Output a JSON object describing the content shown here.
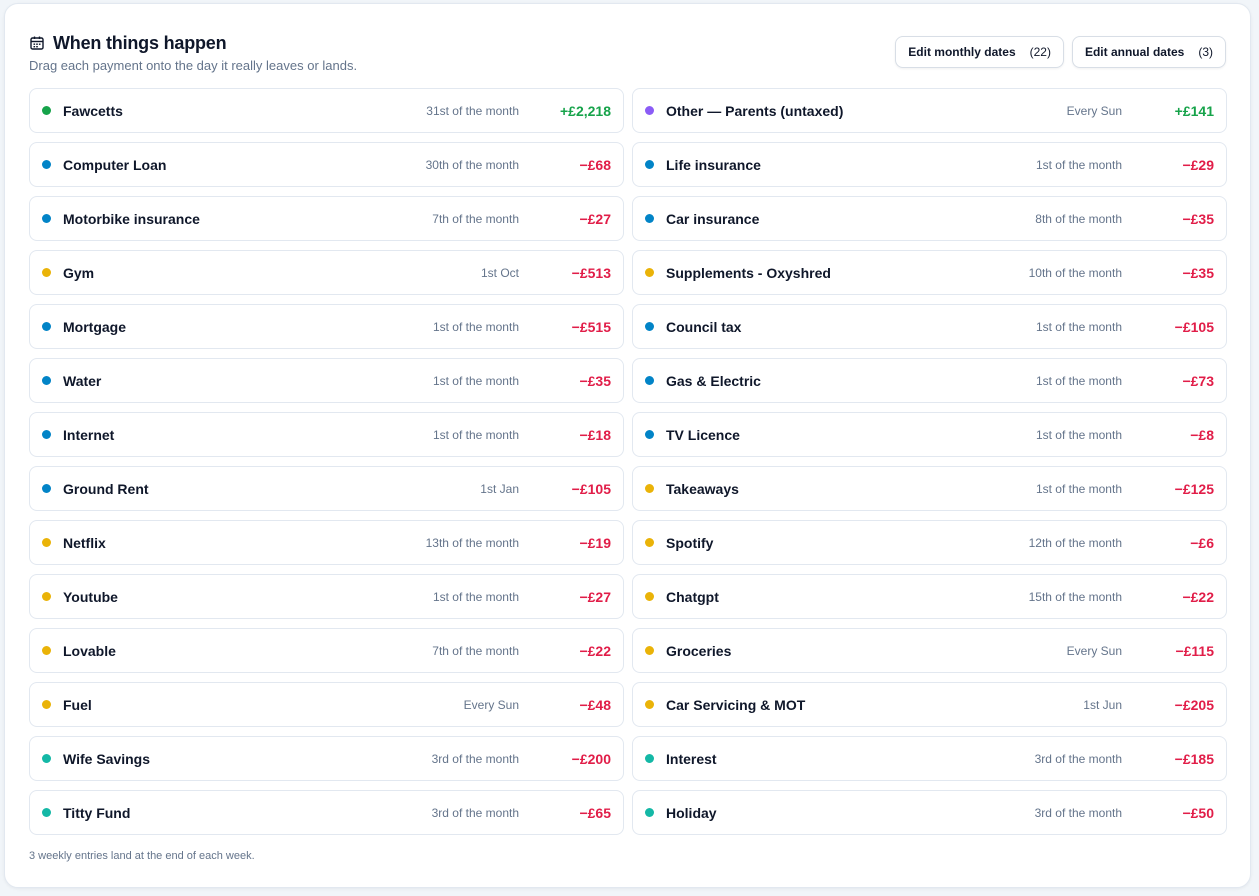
{
  "header": {
    "title": "When things happen",
    "subtitle": "Drag each payment onto the day it really leaves or lands.",
    "icon": "calendar-icon"
  },
  "actions": {
    "monthly": {
      "label": "Edit monthly dates",
      "count": "(22)"
    },
    "annual": {
      "label": "Edit annual dates",
      "count": "(3)"
    }
  },
  "colors": {
    "income": "#16a34a",
    "expense": "#e11d48",
    "green": "#16a34a",
    "purple": "#8b5cf6",
    "blue": "#0284c7",
    "yellow": "#eab308",
    "teal": "#14b8a6"
  },
  "payments": [
    {
      "name": "Fawcetts",
      "when": "31st of the month",
      "amount": "+£2,218",
      "dot": "green",
      "kind": "in"
    },
    {
      "name": "Other — Parents (untaxed)",
      "when": "Every Sun",
      "amount": "+£141",
      "dot": "purple",
      "kind": "in"
    },
    {
      "name": "Computer Loan",
      "when": "30th of the month",
      "amount": "−£68",
      "dot": "blue",
      "kind": "out"
    },
    {
      "name": "Life insurance",
      "when": "1st of the month",
      "amount": "−£29",
      "dot": "blue",
      "kind": "out"
    },
    {
      "name": "Motorbike insurance",
      "when": "7th of the month",
      "amount": "−£27",
      "dot": "blue",
      "kind": "out"
    },
    {
      "name": "Car insurance",
      "when": "8th of the month",
      "amount": "−£35",
      "dot": "blue",
      "kind": "out"
    },
    {
      "name": "Gym",
      "when": "1st Oct",
      "amount": "−£513",
      "dot": "yellow",
      "kind": "out"
    },
    {
      "name": "Supplements - Oxyshred",
      "when": "10th of the month",
      "amount": "−£35",
      "dot": "yellow",
      "kind": "out"
    },
    {
      "name": "Mortgage",
      "when": "1st of the month",
      "amount": "−£515",
      "dot": "blue",
      "kind": "out"
    },
    {
      "name": "Council tax",
      "when": "1st of the month",
      "amount": "−£105",
      "dot": "blue",
      "kind": "out"
    },
    {
      "name": "Water",
      "when": "1st of the month",
      "amount": "−£35",
      "dot": "blue",
      "kind": "out"
    },
    {
      "name": "Gas & Electric",
      "when": "1st of the month",
      "amount": "−£73",
      "dot": "blue",
      "kind": "out"
    },
    {
      "name": "Internet",
      "when": "1st of the month",
      "amount": "−£18",
      "dot": "blue",
      "kind": "out"
    },
    {
      "name": "TV Licence",
      "when": "1st of the month",
      "amount": "−£8",
      "dot": "blue",
      "kind": "out"
    },
    {
      "name": "Ground Rent",
      "when": "1st Jan",
      "amount": "−£105",
      "dot": "blue",
      "kind": "out"
    },
    {
      "name": "Takeaways",
      "when": "1st of the month",
      "amount": "−£125",
      "dot": "yellow",
      "kind": "out"
    },
    {
      "name": "Netflix",
      "when": "13th of the month",
      "amount": "−£19",
      "dot": "yellow",
      "kind": "out"
    },
    {
      "name": "Spotify",
      "when": "12th of the month",
      "amount": "−£6",
      "dot": "yellow",
      "kind": "out"
    },
    {
      "name": "Youtube",
      "when": "1st of the month",
      "amount": "−£27",
      "dot": "yellow",
      "kind": "out"
    },
    {
      "name": "Chatgpt",
      "when": "15th of the month",
      "amount": "−£22",
      "dot": "yellow",
      "kind": "out"
    },
    {
      "name": "Lovable",
      "when": "7th of the month",
      "amount": "−£22",
      "dot": "yellow",
      "kind": "out"
    },
    {
      "name": "Groceries",
      "when": "Every Sun",
      "amount": "−£115",
      "dot": "yellow",
      "kind": "out"
    },
    {
      "name": "Fuel",
      "when": "Every Sun",
      "amount": "−£48",
      "dot": "yellow",
      "kind": "out"
    },
    {
      "name": "Car Servicing & MOT",
      "when": "1st Jun",
      "amount": "−£205",
      "dot": "yellow",
      "kind": "out"
    },
    {
      "name": "Wife Savings",
      "when": "3rd of the month",
      "amount": "−£200",
      "dot": "teal",
      "kind": "out"
    },
    {
      "name": "Interest",
      "when": "3rd of the month",
      "amount": "−£185",
      "dot": "teal",
      "kind": "out"
    },
    {
      "name": "Titty Fund",
      "when": "3rd of the month",
      "amount": "−£65",
      "dot": "teal",
      "kind": "out"
    },
    {
      "name": "Holiday",
      "when": "3rd of the month",
      "amount": "−£50",
      "dot": "teal",
      "kind": "out"
    }
  ],
  "footer": "3 weekly entries land at the end of each week."
}
